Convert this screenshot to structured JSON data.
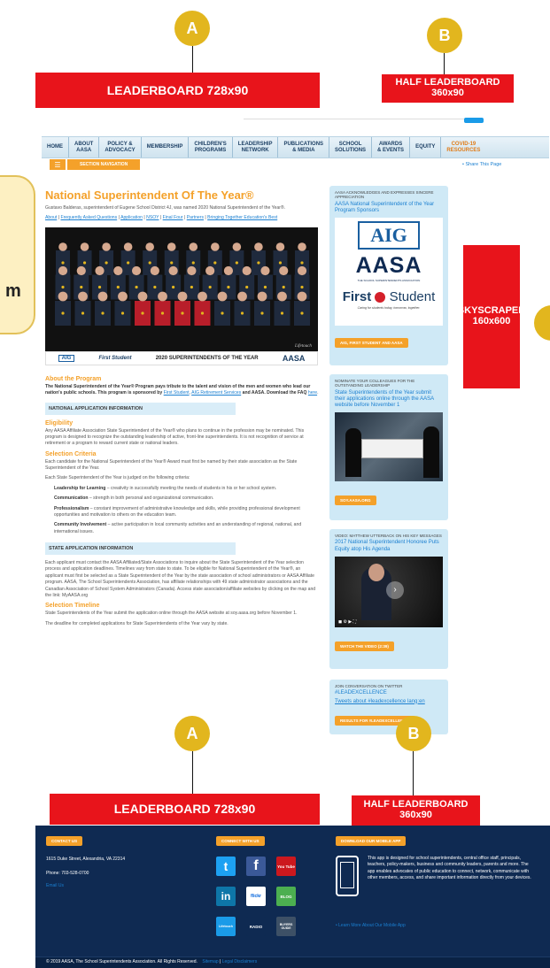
{
  "annotations": {
    "badge_a": "A",
    "badge_b": "B",
    "leaderboard": "LEADERBOARD 728x90",
    "half_leaderboard_line1": "HALF LEADERBOARD",
    "half_leaderboard_line2": "360x90",
    "skyscraper_line1": "SKYSCRAPER",
    "skyscraper_line2": "160x600",
    "side_m": "m"
  },
  "nav": {
    "items": [
      "HOME",
      "ABOUT\nAASA",
      "POLICY &\nADVOCACY",
      "MEMBERSHIP",
      "CHILDREN'S\nPROGRAMS",
      "LEADERSHIP\nNETWORK",
      "PUBLICATIONS\n& MEDIA",
      "SCHOOL\nSOLUTIONS",
      "AWARDS\n& EVENTS",
      "EQUITY",
      "COVID-19\nRESOURCES"
    ],
    "section_navigation": "SECTION NAVIGATION",
    "share": "Share This Page"
  },
  "main": {
    "title": "National Superintendent Of The Year®",
    "intro": "Gustavo Balderas, superintendent of Eugene School District 4J, was named 2020 National Superintendent of the Year®.",
    "links": [
      "About",
      "Frequently Asked Questions",
      "Application",
      "NSOY",
      "Final Four",
      "Partners",
      "Bringing Together Education's Best"
    ],
    "photo_strip": [
      "AIG",
      "First Student",
      "2020 SUPERINTENDENTS OF THE YEAR",
      "AASA"
    ],
    "about_heading": "About the Program",
    "about_text_1": "The National Superintendent of the Year® Program pays tribute to the talent and vision of the men and women who lead our nation's public schools. This program is sponsored by",
    "about_link_1": "First Student",
    "about_link_2": "AIG Retirement Services",
    "about_text_2": "and AASA. Download the FAQ",
    "about_link_3": "here",
    "national_bar": "NATIONAL APPLICATION INFORMATION",
    "eligibility_heading": "Eligibility",
    "eligibility_text": "Any AASA Affiliate Association State Superintendent of the Year® who plans to continue in the profession may be nominated. This program is designed to recognize the outstanding leadership of active, front-line superintendents. It is not recognition of service at retirement or a program to reward current state or national leaders.",
    "selection_heading": "Selection Criteria",
    "selection_text_1": "Each candidate for the National Superintendent of the Year® Award must first be named by their state association as the State Superintendent of the Year.",
    "selection_text_2": "Each State Superintendent of the Year is judged on the following criteria:",
    "criteria": [
      {
        "label": "Leadership for Learning",
        "text": " – creativity in successfully meeting the needs of students in his or her school system."
      },
      {
        "label": "Communication",
        "text": " – strength in both personal and organizational communication."
      },
      {
        "label": "Professionalism",
        "text": " – constant improvement of administrative knowledge and skills, while providing professional development opportunities and motivation to others on the education team."
      },
      {
        "label": "Community Involvement",
        "text": " – active participation in local community activities and an understanding of regional, national, and international issues."
      }
    ],
    "state_bar": "STATE APPLICATION INFORMATION",
    "state_text": "Each applicant must contact the AASA Affiliated/State Associations to inquire about the State Superintendent of the Year selection process and application deadlines. Timelines vary from state to state. To be eligible for National Superintendent of the Year®, an applicant must first be selected as a State Superintendent of the Year by the state association of school administrators or AASA Affiliate program. AASA, The School Superintendents Association, has affiliate relationships with 49 state administrator associations and the Canadian Association of School System Administrators (Canada). Access state association/affiliate websites by clicking on the map and the link: MyAASA.org",
    "timeline_heading": "Selection Timeline",
    "timeline_text": "State Superintendents of the Year submit the application online through the AASA website at soy.aasa.org before November 1.",
    "deadline_text": "The deadline for completed applications for State Superintendents of the Year vary by state."
  },
  "sidebar": {
    "card1": {
      "small": "AASA ACKNOWLEDGES AND EXPRESSES SINCERE APPRECIATION",
      "link": "AASA National Superintendent of the Year Program Sponsors",
      "aig": "AIG",
      "aasa": "AASA",
      "aasa_sub": "THE SCHOOL SUPERINTENDENTS ASSOCIATION",
      "first": "First",
      "student": "Student",
      "tagline": "Caring for students today, tomorrow, together.",
      "button": "AIG, FIRST STUDENT AND AASA"
    },
    "card2": {
      "small": "NOMINATE YOUR COLLEAGUES FOR THE OUTSTANDING LEADERSHIP",
      "link": "State Superintendents of the Year submit their applications online through the AASA website before November 1",
      "button": "SOY.AASA.ORG"
    },
    "card3": {
      "small": "VIDEO: MATTHEW UTTERBACK ON HIS KEY MESSAGES",
      "link": "2017 National Superintendent Honoree Puts Equity atop His Agenda",
      "button": "WATCH THE VIDEO (2:39)"
    },
    "card4": {
      "small": "JOIN CONVERSATION ON TWITTER",
      "hashtag": "#LEADEXCELLENCE",
      "link": "Tweets about #leadexcellence lang:en",
      "button": "RESULTS FOR #LEADEXCELLENCE"
    }
  },
  "footer": {
    "contact_btn": "CONTACT US",
    "address": "1615 Duke Street, Alexandria, VA 22314",
    "phone": "Phone: 703-528-0700",
    "email": "Email Us",
    "connect_btn": "CONNECT WITH US",
    "app_btn": "DOWNLOAD OUR MOBILE APP",
    "app_text": "This app is designed for school superintendents, central office staff, principals, teachers, policy-makers, business and community leaders, parents and more. The app enables advocates of public education to connect, network, communicate with other members, access, and share important information directly from your devices.",
    "learn_more": "• Learn More About Our Mobile App",
    "copyright": "© 2019 AASA, The School Superintendents Association. All Rights Reserved.",
    "sitemap": "Sitemap",
    "legal": "Legal Disclaimers",
    "social": {
      "twitter": "t",
      "facebook": "f",
      "youtube": "You Tube",
      "linkedin": "in",
      "flickr": "flickr",
      "blog": "BLOG",
      "lifetouch": "Lifetouch",
      "radio": "RADIO",
      "buyers": "BUYERS GUIDE"
    }
  },
  "colors": {
    "orange": "#f4a12a",
    "navy": "#0f2a52",
    "red": "#e8141b",
    "light_blue": "#cfe9f6",
    "gold": "#e2b61e"
  }
}
